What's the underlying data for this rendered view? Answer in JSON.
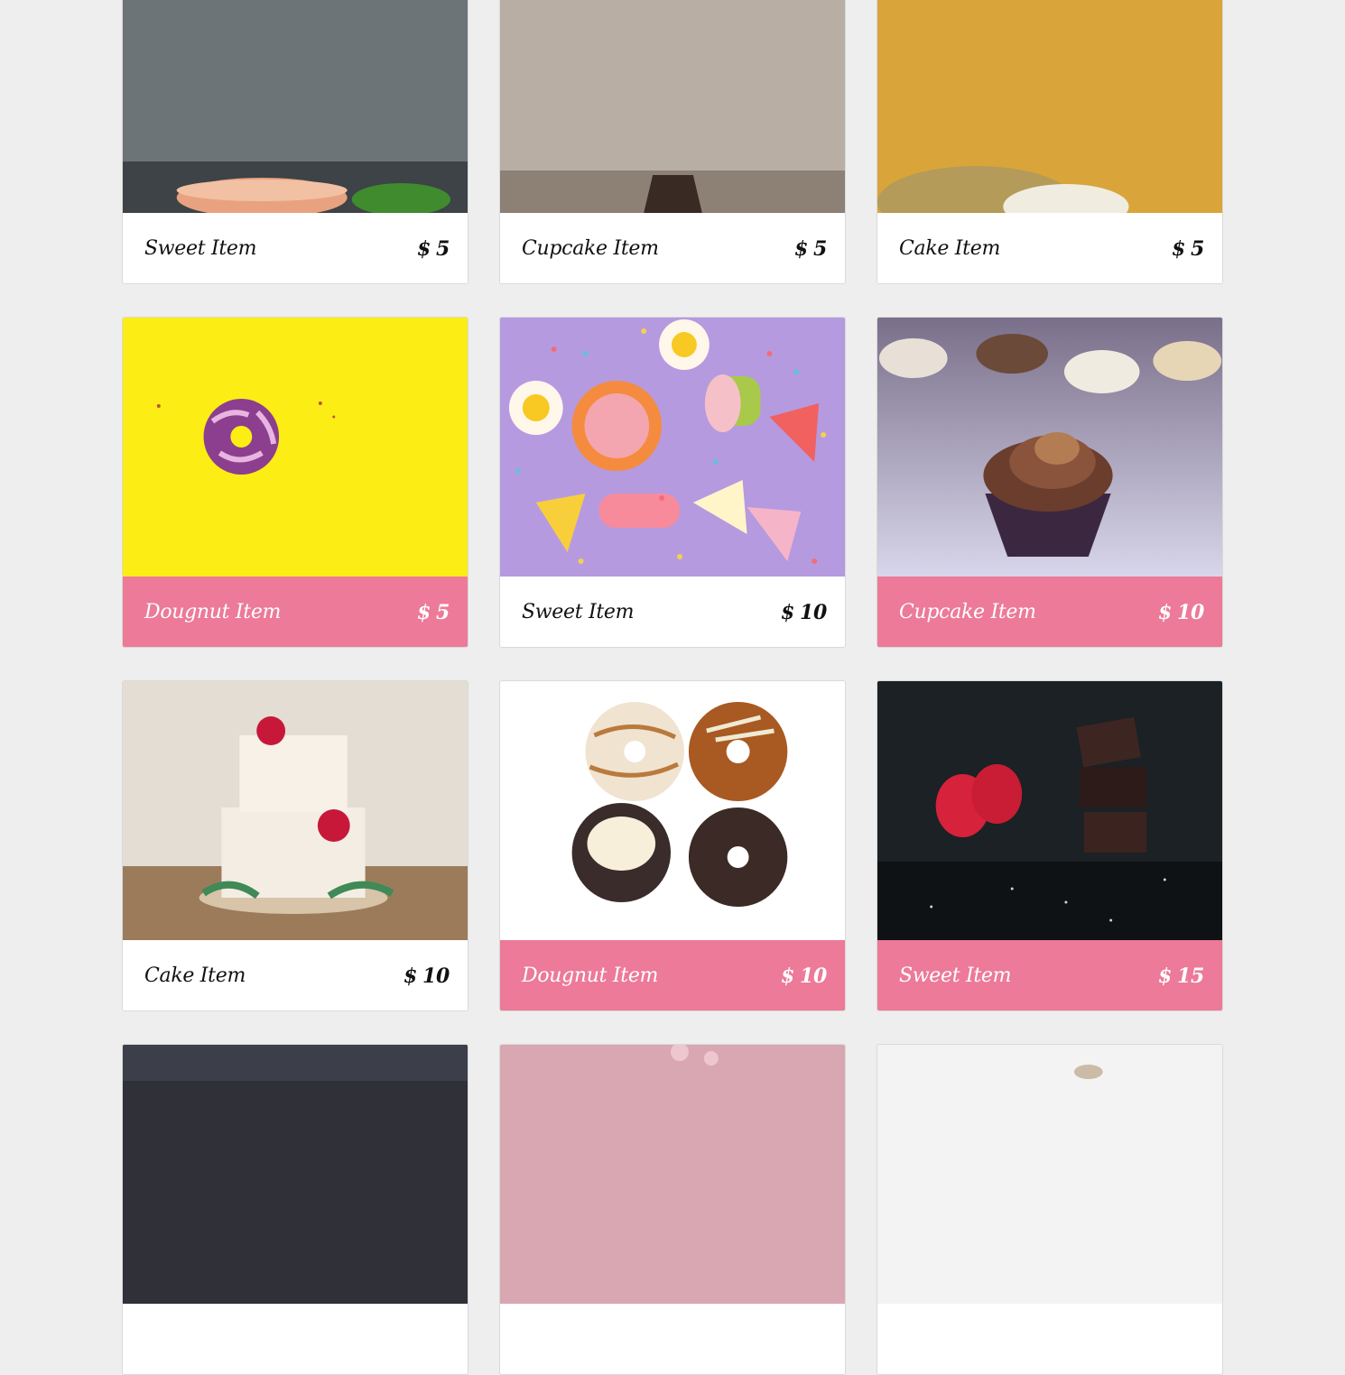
{
  "colors": {
    "accent": "#ec7a98",
    "page_background": "#eeeeee",
    "card_background": "#ffffff"
  },
  "currency": "$",
  "items": [
    {
      "name": "Sweet Item",
      "price": "5",
      "photo": "macaron-photo"
    },
    {
      "name": "Cupcake Item",
      "price": "5",
      "photo": "cupcake-photo"
    },
    {
      "name": "Cake Item",
      "price": "5",
      "photo": "cake-photo"
    },
    {
      "name": "Dougnut Item",
      "price": "5",
      "photo": "donut-yellow-photo",
      "highlighted": true
    },
    {
      "name": "Sweet Item",
      "price": "10",
      "photo": "candy-photo"
    },
    {
      "name": "Cupcake Item",
      "price": "10",
      "photo": "chocolate-cupcake-photo",
      "highlighted": true
    },
    {
      "name": "Cake Item",
      "price": "10",
      "photo": "floral-cake-photo"
    },
    {
      "name": "Dougnut Item",
      "price": "10",
      "photo": "four-donuts-photo",
      "highlighted": true
    },
    {
      "name": "Sweet Item",
      "price": "15",
      "photo": "chocolate-raspberry-photo",
      "highlighted": true
    }
  ]
}
